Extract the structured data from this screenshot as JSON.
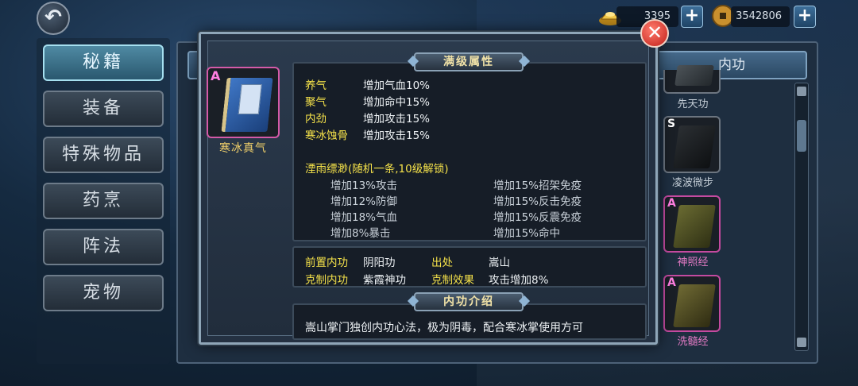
{
  "topbar": {
    "gold_amount": "3395",
    "coin_amount": "3542806",
    "plus_symbol": "+",
    "back_symbol": "↶"
  },
  "left_menu": [
    {
      "label": "秘籍",
      "active": true
    },
    {
      "label": "装备",
      "active": false
    },
    {
      "label": "特殊物品",
      "active": false
    },
    {
      "label": "药烹",
      "active": false
    },
    {
      "label": "阵法",
      "active": false
    },
    {
      "label": "宠物",
      "active": false
    }
  ],
  "right_tab": {
    "label": "内功"
  },
  "right_list": [
    {
      "grade": "",
      "name": "先天功"
    },
    {
      "grade": "S",
      "name": "凌波微步"
    },
    {
      "grade": "A",
      "name": "神照经"
    },
    {
      "grade": "A",
      "name": "洗髓经"
    }
  ],
  "modal": {
    "close_symbol": "✕",
    "book": {
      "grade": "A",
      "name": "寒冰真气"
    },
    "full_level_title": "满级属性",
    "attributes": [
      {
        "name": "养气",
        "effect": "增加气血10%"
      },
      {
        "name": "聚气",
        "effect": "增加命中15%"
      },
      {
        "name": "内劲",
        "effect": "增加攻击15%"
      },
      {
        "name": "寒冰蚀骨",
        "effect": "增加攻击15%"
      }
    ],
    "random_header": "湮雨缥渺(随机一条,10级解锁)",
    "random_left": [
      "增加13%攻击",
      "增加12%防御",
      "增加18%气血",
      "增加8%暴击"
    ],
    "random_right": [
      "增加15%招架免疫",
      "增加15%反击免疫",
      "增加15%反震免疫",
      "增加15%命中"
    ],
    "info": {
      "prereq_label": "前置内功",
      "prereq_value": "阴阳功",
      "source_label": "出处",
      "source_value": "嵩山",
      "counter_label": "克制内功",
      "counter_value": "紫霞神功",
      "counter_effect_label": "克制效果",
      "counter_effect_value": "攻击增加8%"
    },
    "intro_title": "内功介绍",
    "intro_text": "嵩山掌门独创内功心法，极为阴毒，配合寒冰掌使用方可"
  },
  "colors": {
    "accent_yellow": "#f5e24a",
    "grade_a_pink": "#d45aa8",
    "close_red": "#c0201a"
  }
}
